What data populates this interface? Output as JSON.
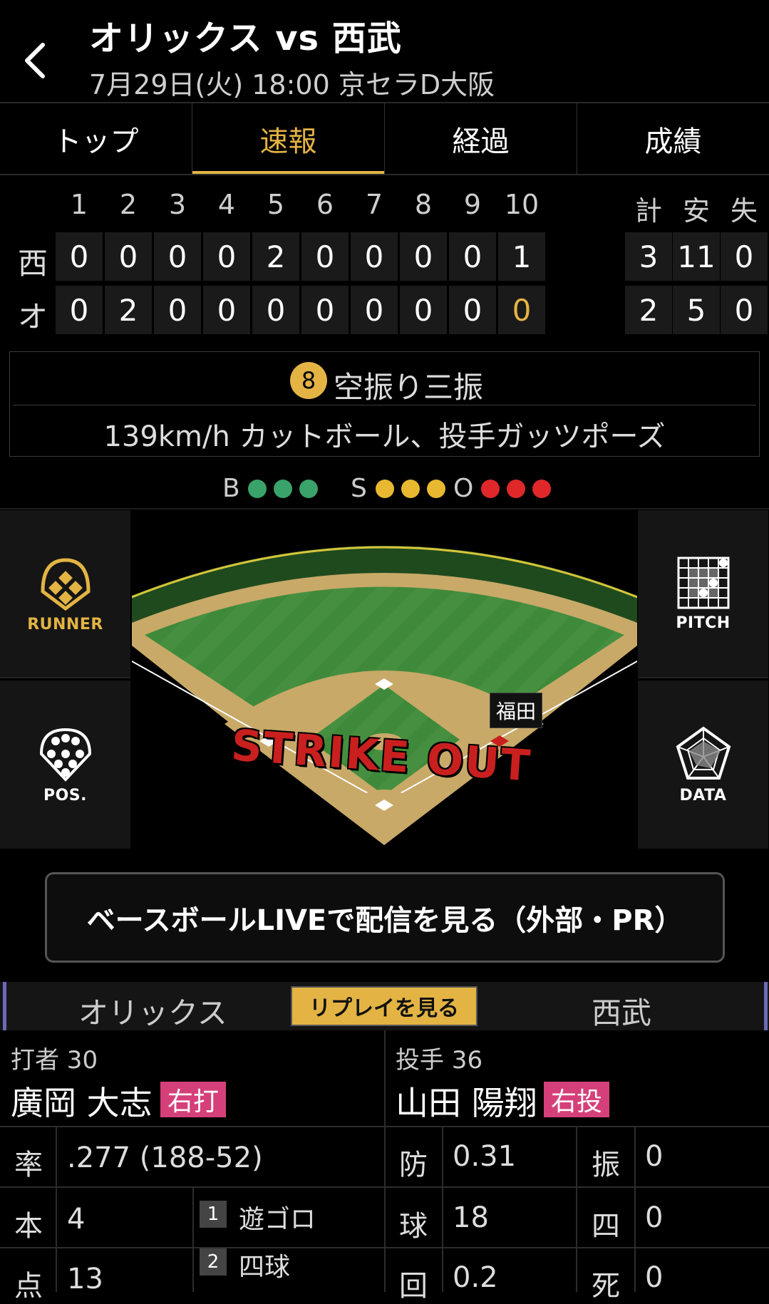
{
  "header": {
    "title": "オリックス vs 西武",
    "subtitle": "7月29日(火) 18:00 京セラD大阪"
  },
  "tabs": [
    {
      "label": "トップ",
      "active": false
    },
    {
      "label": "速報",
      "active": true
    },
    {
      "label": "経過",
      "active": false
    },
    {
      "label": "成績",
      "active": false
    }
  ],
  "scoreboard": {
    "innings": [
      "1",
      "2",
      "3",
      "4",
      "5",
      "6",
      "7",
      "8",
      "9",
      "10"
    ],
    "totals_headers": [
      "計",
      "安",
      "失"
    ],
    "rows": [
      {
        "team": "西",
        "scores": [
          "0",
          "0",
          "0",
          "0",
          "2",
          "0",
          "0",
          "0",
          "0",
          "1"
        ],
        "totals": [
          "3",
          "11",
          "0"
        ]
      },
      {
        "team": "オ",
        "scores": [
          "0",
          "2",
          "0",
          "0",
          "0",
          "0",
          "0",
          "0",
          "0",
          "0"
        ],
        "totals": [
          "2",
          "5",
          "0"
        ]
      }
    ]
  },
  "play": {
    "number": "8",
    "title": "空振り三振",
    "detail": "139km/h カットボール、投手ガッツポーズ"
  },
  "count": {
    "b_label": "B",
    "s_label": "S",
    "o_label": "O",
    "balls": 3,
    "strikes": 3,
    "outs": 3,
    "colors": {
      "ball": "#3aa36a",
      "strike": "#e8b830",
      "out": "#e0282a"
    }
  },
  "field": {
    "runner_name": "福田",
    "overlay_text": "STRIKE OUT"
  },
  "side_buttons": {
    "runner": "RUNNER",
    "pitch": "PITCH",
    "pos": "POS.",
    "data": "DATA"
  },
  "live_button": "ベースボールLIVEで配信を見る（外部・PR）",
  "teams_bar": {
    "left_team": "オリックス",
    "replay": "リプレイを見る",
    "right_team": "西武"
  },
  "batter": {
    "role": "打者 30",
    "name": "廣岡 大志",
    "hand": "右打",
    "stats": [
      {
        "k": "率",
        "v": ".277 (188-52)"
      },
      {
        "k": "本",
        "v": "4"
      },
      {
        "k": "点",
        "v": "13"
      }
    ],
    "history": [
      {
        "n": "1",
        "t": "遊ゴロ"
      },
      {
        "n": "2",
        "t": "四球"
      }
    ]
  },
  "pitcher": {
    "role": "投手 36",
    "name": "山田 陽翔",
    "hand": "右投",
    "stats_left": [
      {
        "k": "防",
        "v": "0.31"
      },
      {
        "k": "球",
        "v": "18"
      },
      {
        "k": "回",
        "v": "0.2"
      }
    ],
    "stats_right": [
      {
        "k": "振",
        "v": "0"
      },
      {
        "k": "四",
        "v": "0"
      },
      {
        "k": "死",
        "v": "0"
      }
    ]
  }
}
